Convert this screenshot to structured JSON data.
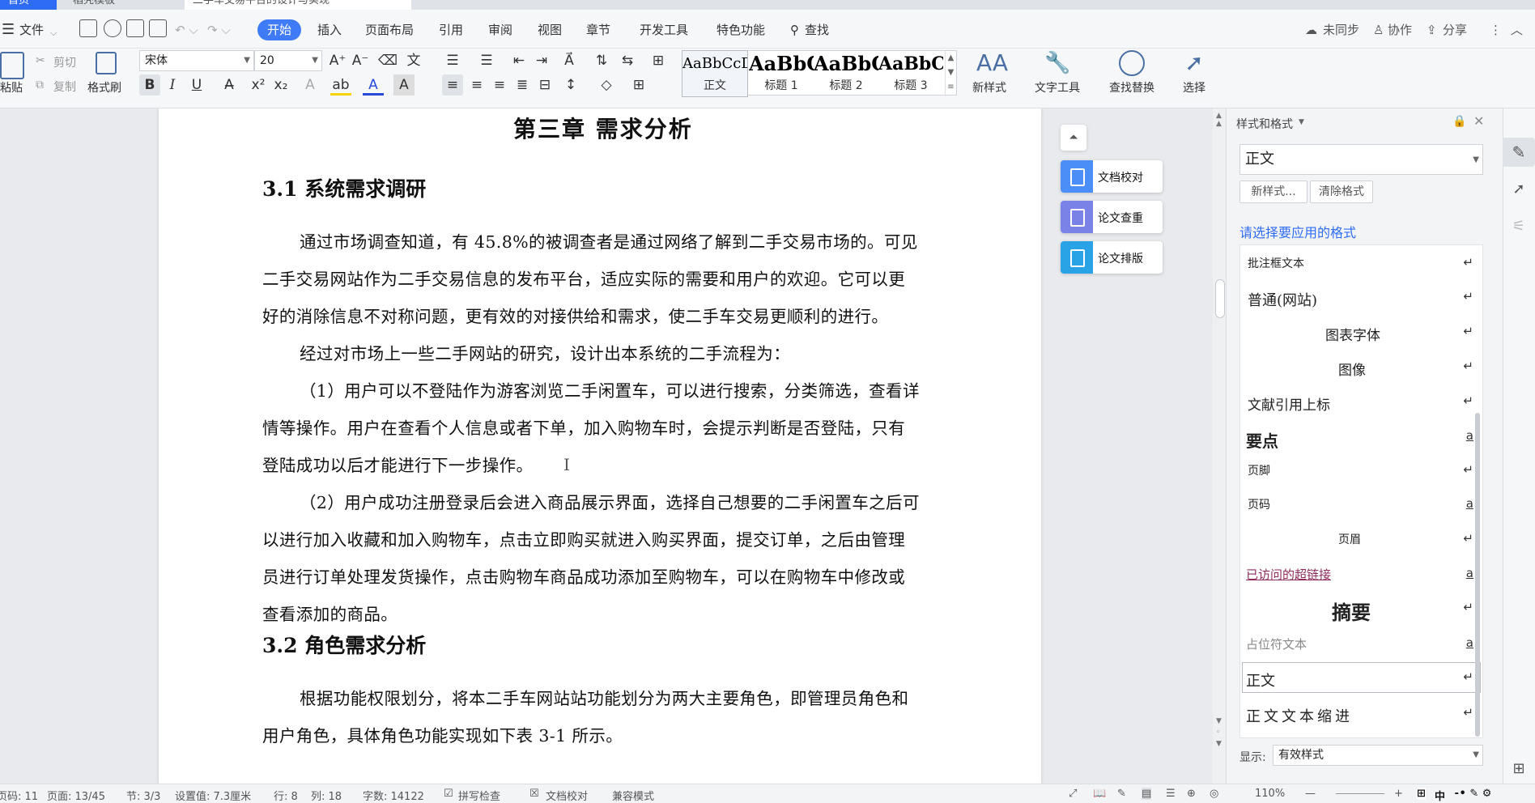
{
  "tabs": {
    "home": "首页",
    "doc1": "稻壳模板",
    "doc2": "二手车交易平台的设计与实现"
  },
  "menu": {
    "file": "文件",
    "items": [
      "开始",
      "插入",
      "页面布局",
      "引用",
      "审阅",
      "视图",
      "章节",
      "开发工具",
      "特色功能"
    ],
    "search": "查找",
    "sync": "未同步",
    "collab": "协作",
    "share": "分享"
  },
  "ribbon": {
    "paste": "粘贴",
    "cut": "剪切",
    "copy": "复制",
    "format_painter": "格式刷",
    "font_name": "宋体",
    "font_size": "20",
    "bold": "B",
    "italic": "I",
    "underline": "U",
    "styles": [
      {
        "preview": "AaBbCcDd",
        "label": "正文"
      },
      {
        "preview": "AaBbC",
        "label": "标题 1"
      },
      {
        "preview": "AaBbC",
        "label": "标题 2"
      },
      {
        "preview": "AaBbC",
        "label": "标题 3"
      }
    ],
    "new_style": "新样式",
    "text_tools": "文字工具",
    "find_replace": "查找替换",
    "select": "选择"
  },
  "document": {
    "chapter_title": "第三章  需求分析",
    "s31_title": "3.1  系统需求调研",
    "p1": [
      "通过市场调查知道，有 45.8%的被调查者是通过网络了解到二手交易市场的。可见",
      "二手交易网站作为二手交易信息的发布平台，适应实际的需要和用户的欢迎。它可以更",
      "好的消除信息不对称问题，更有效的对接供给和需求，使二手车交易更顺利的进行。"
    ],
    "p2": "经过对市场上一些二手网站的研究，设计出本系统的二手流程为：",
    "p3": [
      "（1）用户可以不登陆作为游客浏览二手闲置车，可以进行搜索，分类筛选，查看详",
      "情等操作。用户在查看个人信息或者下单，加入购物车时，会提示判断是否登陆，只有",
      "登陆成功以后才能进行下一步操作。"
    ],
    "p4": [
      "（2）用户成功注册登录后会进入商品展示界面，选择自己想要的二手闲置车之后可",
      "以进行加入收藏和加入购物车，点击立即购买就进入购买界面，提交订单，之后由管理",
      "员进行订单处理发货操作，点击购物车商品成功添加至购物车，可以在购物车中修改或",
      "查看添加的商品。"
    ],
    "s32_title": "3.2  角色需求分析",
    "p5": [
      "根据功能权限划分，将本二手车网站站功能划分为两大主要角色，即管理员角色和",
      "用户角色，具体角色功能实现如下表 3-1 所示。"
    ]
  },
  "float_buttons": [
    "文档校对",
    "论文查重",
    "论文排版"
  ],
  "style_pane": {
    "title": "样式和格式",
    "current": "正文",
    "new_style_btn": "新样式...",
    "clear_btn": "清除格式",
    "hint": "请选择要应用的格式",
    "items": [
      {
        "name": "批注框文本",
        "mark": "↵"
      },
      {
        "name": "普通(网站)",
        "mark": "↵"
      },
      {
        "name": "图表字体",
        "mark": "↵"
      },
      {
        "name": "图像",
        "mark": "↵"
      },
      {
        "name": "文献引用上标",
        "mark": "↵"
      },
      {
        "name": "要点",
        "mark": "a"
      },
      {
        "name": "页脚",
        "mark": "↵"
      },
      {
        "name": "页码",
        "mark": "a"
      },
      {
        "name": "页眉",
        "mark": "↵"
      },
      {
        "name": "已访问的超链接",
        "mark": "a"
      },
      {
        "name": "摘要",
        "mark": "↵"
      },
      {
        "name": "占位符文本",
        "mark": "a"
      },
      {
        "name": "正文",
        "mark": "↵"
      },
      {
        "name": "正文文本缩进",
        "mark": "↵"
      }
    ],
    "show_label": "显示:",
    "show_value": "有效样式"
  },
  "status": {
    "page_code": "页码: 11",
    "page": "页面: 13/45",
    "section": "节: 3/3",
    "setting": "设置值: 7.3厘米",
    "row": "行: 8",
    "col": "列: 18",
    "words": "字数: 14122",
    "spell": "拼写检查",
    "proof": "文档校对",
    "compat": "兼容模式",
    "zoom": "110%",
    "ime": "中"
  }
}
